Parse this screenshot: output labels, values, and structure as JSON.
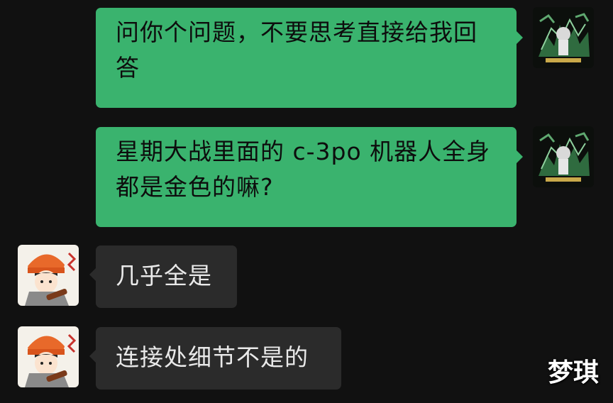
{
  "messages": [
    {
      "side": "right",
      "sender": "self",
      "text": "问你个问题，不要思考直接给我回答"
    },
    {
      "side": "right",
      "sender": "self",
      "text": "星期大战里面的 c-3po 机器人全身都是金色的嘛?"
    },
    {
      "side": "left",
      "sender": "other",
      "text": "几乎全是"
    },
    {
      "side": "left",
      "sender": "other",
      "text": "连接处细节不是的"
    }
  ],
  "watermark": "梦琪",
  "avatars": {
    "self": "dark-green-illustration-avatar",
    "other": "cartoon-boy-orange-beanie-avatar"
  },
  "colors": {
    "background": "#111111",
    "outgoing_bubble": "#3ab36e",
    "incoming_bubble": "#2b2b2b"
  }
}
